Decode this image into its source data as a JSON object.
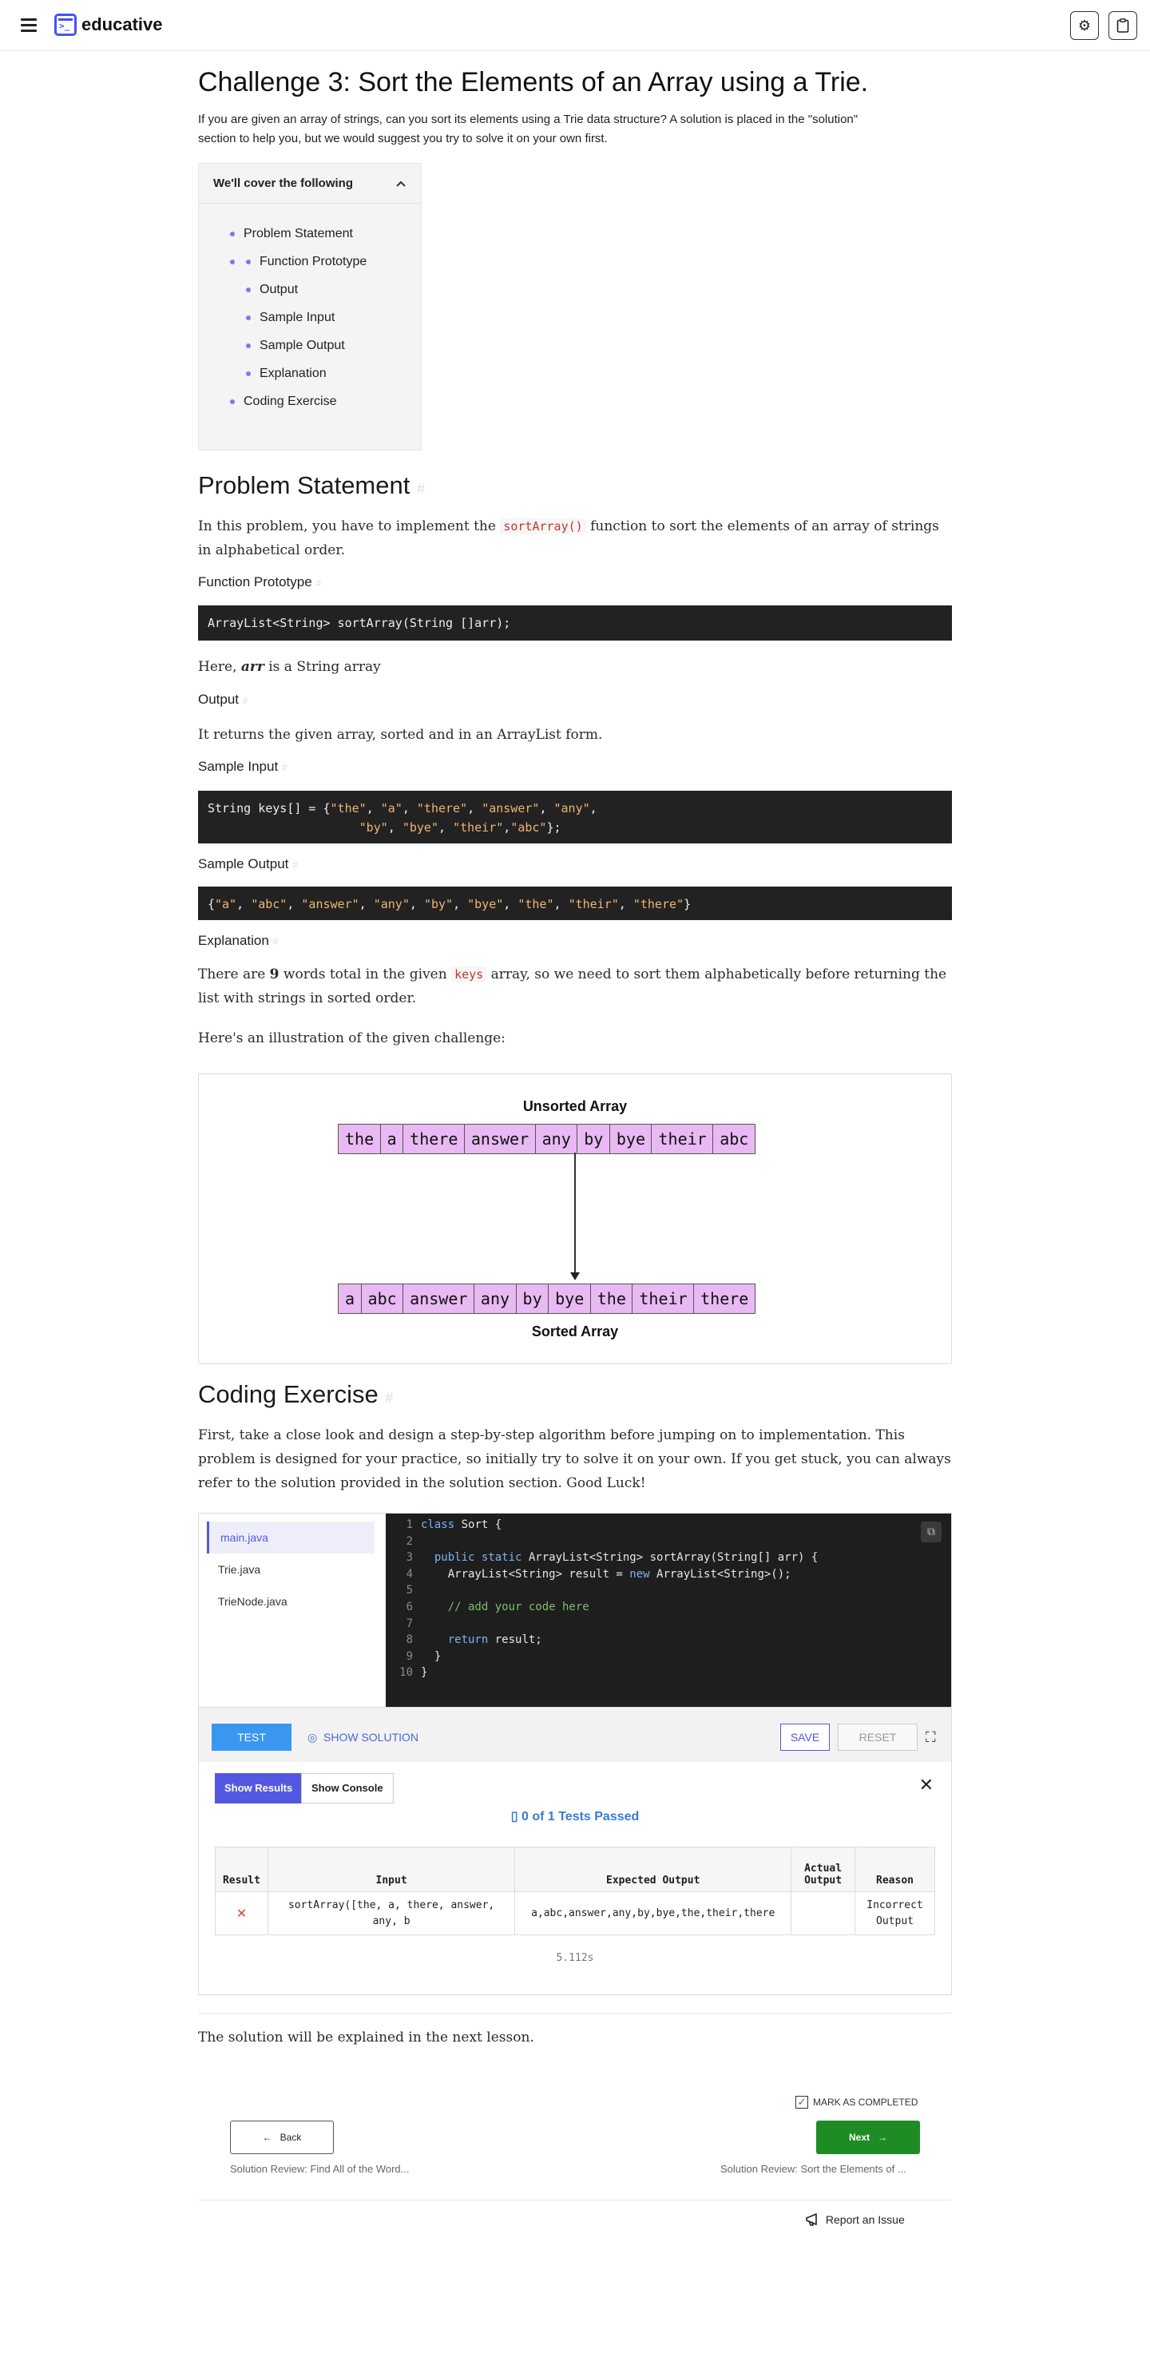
{
  "header": {
    "brand": "educative",
    "settings_icon": "⚙",
    "clipboard_icon": "📋"
  },
  "lesson": {
    "title": "Challenge 3: Sort the Elements of an Array using a Trie.",
    "intro_line1": "If you are given an array of strings, can you sort its elements using a Trie data structure? A solution is placed in the \"solution\"",
    "intro_line2": "section to help you, but we would suggest you try to solve it on your own first."
  },
  "toc": {
    "heading": "We'll cover the following",
    "items": [
      "Problem Statement",
      "",
      "Function Prototype",
      "Output",
      "Sample Input",
      "Sample Output",
      "Explanation",
      "Coding Exercise"
    ]
  },
  "problem": {
    "heading": "Problem Statement",
    "text_before": "In this problem, you have to implement the ",
    "fn_code": "sortArray()",
    "text_after_line1": " function to sort the elements of an array of strings",
    "text_line2": "in alphabetical order.",
    "fp_heading": "Function Prototype",
    "fp_code": "ArrayList<String> sortArray(String []arr);",
    "here": "Here, ",
    "arr_word": "arr",
    "here_rest": " is a String array",
    "output_heading": "Output",
    "output_text": "It returns the given array, sorted and in an ArrayList form.",
    "sample_input_heading": "Sample Input",
    "sample_output_heading": "Sample Output",
    "explanation_heading": "Explanation",
    "expl_a": "There are ",
    "expl_num": "9",
    "expl_b": " words total in the given ",
    "expl_code": "keys",
    "expl_c": " array, so we need to sort them alphabetically before returning the",
    "expl_line2": "list with strings in sorted order.",
    "illus_intro": "Here's an illustration of the given challenge:"
  },
  "illustration": {
    "unsorted_title": "Unsorted Array",
    "sorted_title": "Sorted Array",
    "unsorted": [
      "the",
      "a",
      "there",
      "answer",
      "any",
      "by",
      "bye",
      "their",
      "abc"
    ],
    "sorted": [
      "a",
      "abc",
      "answer",
      "any",
      "by",
      "bye",
      "the",
      "their",
      "there"
    ]
  },
  "exercise": {
    "heading": "Coding Exercise",
    "line1": "First, take a close look and design a step-by-step algorithm before jumping on to implementation. This",
    "line2": "problem is designed for your practice, so initially try to solve it on your own. If you get stuck, you can always",
    "line3": "refer to the solution provided in the solution section. Good Luck!"
  },
  "editor": {
    "files": [
      "main.java",
      "Trie.java",
      "TrieNode.java"
    ],
    "test_label": "TEST",
    "show_solution_label": "SHOW SOLUTION",
    "save_label": "SAVE",
    "reset_label": "RESET"
  },
  "results": {
    "show_results": "Show Results",
    "show_console": "Show Console",
    "passed": "0 of 1 Tests Passed",
    "col_result": "Result",
    "col_input": "Input",
    "col_expected": "Expected Output",
    "col_actual_1": "Actual",
    "col_actual_2": "Output",
    "col_reason": "Reason",
    "row_input_1": "sortArray([the, a, there, answer,",
    "row_input_2": "any, b",
    "row_expected": "a,abc,answer,any,by,bye,the,their,there",
    "row_actual": "",
    "row_reason_1": "Incorrect",
    "row_reason_2": "Output",
    "time": "5.112s"
  },
  "footer": {
    "next_lesson_note": "The solution will be explained in the next lesson.",
    "mark_completed": "MARK AS COMPLETED",
    "back": "Back",
    "next": "Next",
    "prev_title": "Solution Review: Find All of the Word...",
    "next_title": "Solution Review: Sort the Elements of ...",
    "report": "Report an Issue"
  }
}
